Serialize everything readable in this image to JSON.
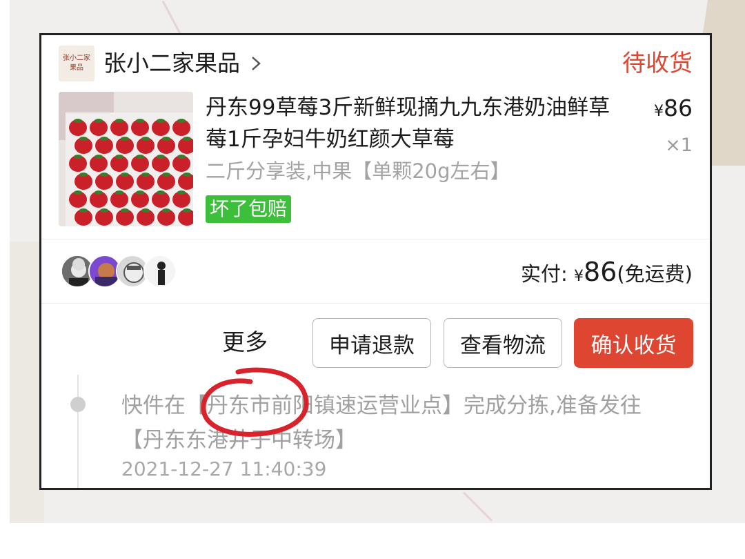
{
  "store": {
    "logo_text": "张小二家 果品",
    "name": "张小二家果品",
    "order_status": "待收货"
  },
  "product": {
    "title": "丹东99草莓3斤新鲜现摘九九东港奶油鲜草莓1斤孕妇牛奶红颜大草莓",
    "currency": "¥",
    "price": "86",
    "quantity": "×1",
    "sku": "二斤分享装,中果【单颗20g左右】",
    "badge": "坏了包赔"
  },
  "payment": {
    "label": "实付:",
    "currency": "¥",
    "amount": "86",
    "note": "(免运费)"
  },
  "actions": {
    "more_label": "更多",
    "refund_label": "申请退款",
    "logistics_label": "查看物流",
    "confirm_label": "确认收货"
  },
  "logistics": {
    "text": "快件在【丹东市前阳镇速运营业点】完成分拣,准备发往 【丹东东港井子中转场】",
    "time": "2021-12-27 11:40:39"
  },
  "colors": {
    "accent_red": "#de4632",
    "status_red": "#e0452f",
    "badge_green": "#3cbf3a",
    "annotation_red": "#d9232c"
  }
}
